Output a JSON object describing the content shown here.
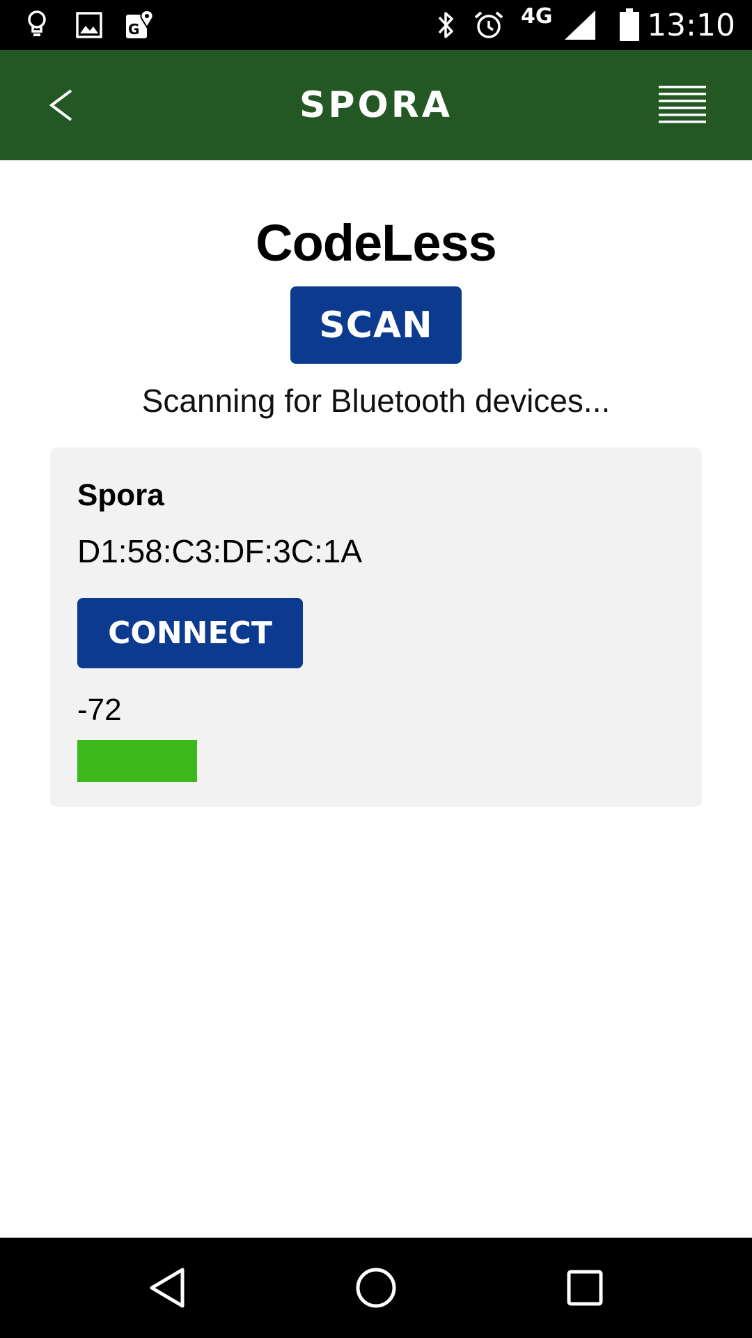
{
  "status_bar": {
    "icons_left": [
      "lightbulb-icon",
      "image-icon",
      "maps-icon"
    ],
    "icons_right": [
      "bluetooth-icon",
      "alarm-icon",
      "cell-signal-icon",
      "battery-icon"
    ],
    "network": "4G",
    "time": "13:10"
  },
  "header": {
    "logo_text": "SPORA",
    "background_color": "#235824"
  },
  "main": {
    "title": "CodeLess",
    "scan_label": "SCAN",
    "status_text": "Scanning for Bluetooth devices..."
  },
  "devices": [
    {
      "name": "Spora",
      "address": "D1:58:C3:DF:3C:1A",
      "connect_label": "CONNECT",
      "rssi": "-72",
      "signal_fraction": 0.41
    }
  ],
  "colors": {
    "button": "#0c3a8e",
    "signal_bar": "#3cb81a",
    "card": "#f2f2f2"
  },
  "nav_bar": {
    "buttons": [
      "back-triangle-icon",
      "home-circle-icon",
      "recents-square-icon"
    ]
  }
}
